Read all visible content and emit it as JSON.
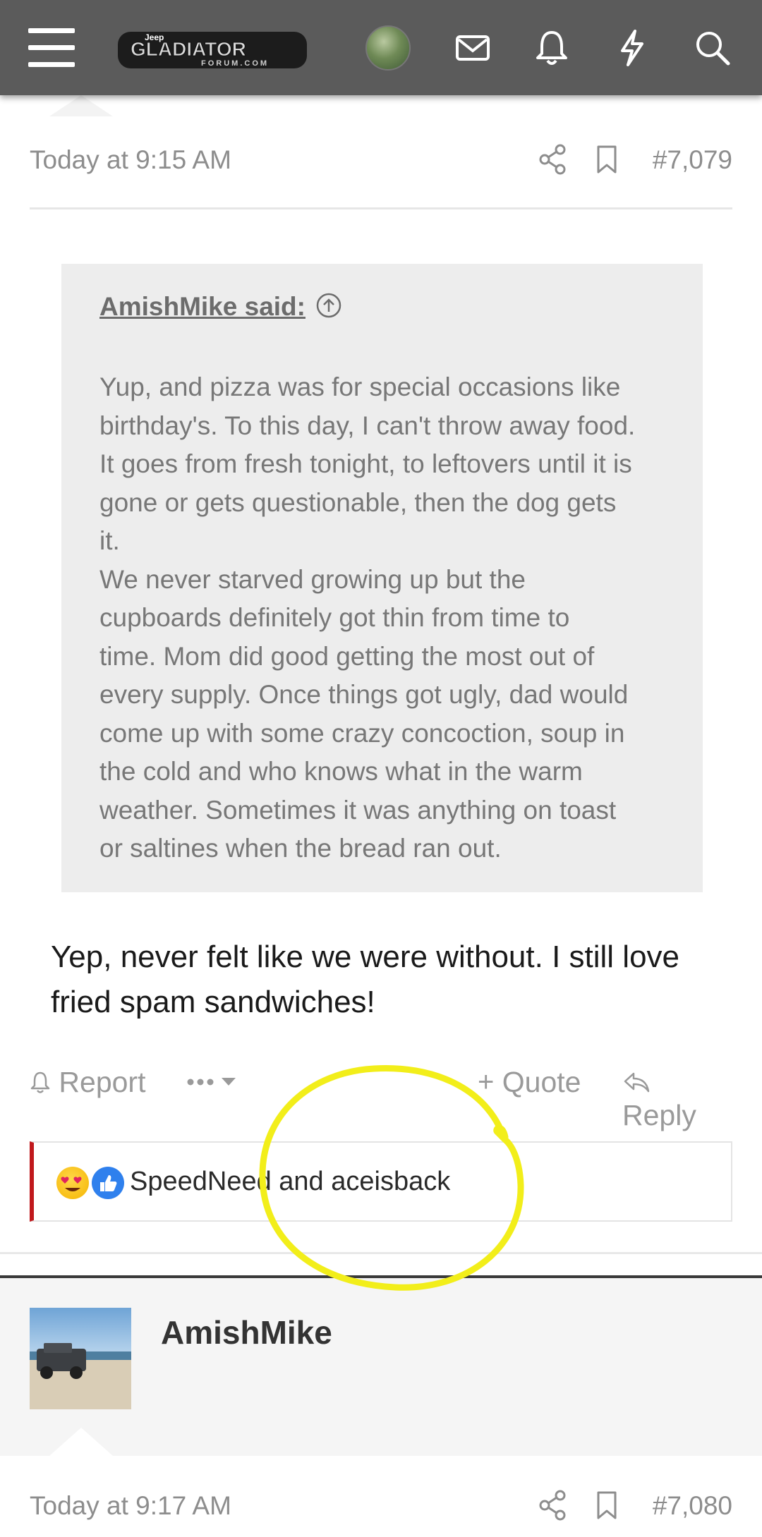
{
  "header": {
    "logo_text": "GLADIATOR",
    "logo_brand": "Jeep",
    "logo_sub": "FORUM.COM",
    "icons": [
      "menu-icon",
      "avatar",
      "mail-icon",
      "bell-icon",
      "lightning-icon",
      "search-icon"
    ]
  },
  "post1": {
    "time": "Today at 9:15 AM",
    "number": "#7,079",
    "quote": {
      "author": "AmishMike said:",
      "lines": [
        "Yup, and pizza was for special occasions like",
        "birthday's. To this day, I can't throw away food.",
        "It goes from fresh tonight, to leftovers until it is",
        "gone or gets questionable, then the dog gets",
        "it.",
        "We never starved growing up but the",
        "cupboards definitely got thin from time to",
        "time. Mom did good getting the most out of",
        "every supply. Once things got ugly, dad would",
        "come up with some crazy concoction, soup in",
        "the cold and who knows what in the warm",
        "weather. Sometimes it was anything on toast",
        "or saltines when the bread ran out."
      ]
    },
    "reply_lines": [
      "Yep, never felt like we were without. I still love",
      "fried spam sandwiches!"
    ],
    "actions": {
      "report": "Report",
      "quote": "Quote",
      "reply": "Reply"
    },
    "reactions": {
      "names": "SpeedNeed and aceisback"
    }
  },
  "post2": {
    "author": "AmishMike",
    "time": "Today at 9:17 AM",
    "number": "#7,080"
  },
  "colors": {
    "header_bg": "#5b5b5b",
    "accent_red": "#c0181c",
    "annotation_yellow": "#f2ee1a",
    "quote_bg": "#ededed"
  }
}
